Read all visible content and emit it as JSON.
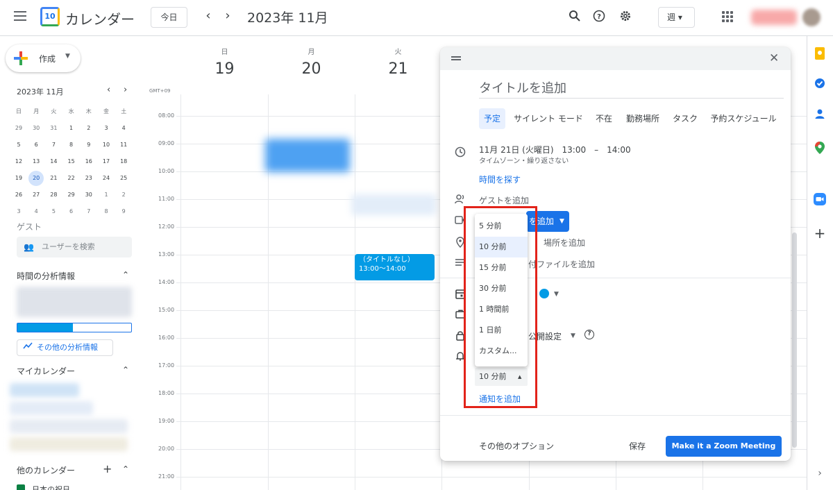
{
  "header": {
    "app_name": "カレンダー",
    "logo_number": "10",
    "today_button": "今日",
    "prev": "‹",
    "next": "›",
    "month_title": "2023年 11月",
    "view_selector": "週 ▾"
  },
  "sidebar": {
    "create_label": "作成",
    "mini_cal": {
      "title": "2023年 11月",
      "dows": [
        "日",
        "月",
        "火",
        "水",
        "木",
        "金",
        "土"
      ],
      "weeks": [
        [
          "29",
          "30",
          "31",
          "1",
          "2",
          "3",
          "4"
        ],
        [
          "5",
          "6",
          "7",
          "8",
          "9",
          "10",
          "11"
        ],
        [
          "12",
          "13",
          "14",
          "15",
          "16",
          "17",
          "18"
        ],
        [
          "19",
          "20",
          "21",
          "22",
          "23",
          "24",
          "25"
        ],
        [
          "26",
          "27",
          "28",
          "29",
          "30",
          "1",
          "2"
        ],
        [
          "3",
          "4",
          "5",
          "6",
          "7",
          "8",
          "9"
        ]
      ]
    },
    "guest_label": "ゲスト",
    "search_users_placeholder": "ユーザーを検索",
    "time_insights": "時間の分析情報",
    "more_insights": "その他の分析情報",
    "my_calendars": "マイカレンダー",
    "other_calendars": "他のカレンダー",
    "other_cal_item": "日本の祝日"
  },
  "week": {
    "timezone": "GMT+09",
    "days": [
      {
        "dow": "日",
        "num": "19"
      },
      {
        "dow": "月",
        "num": "20"
      },
      {
        "dow": "火",
        "num": "21"
      }
    ],
    "hours": [
      "08:00",
      "09:00",
      "10:00",
      "11:00",
      "12:00",
      "13:00",
      "14:00",
      "15:00",
      "16:00",
      "17:00",
      "18:00",
      "19:00",
      "20:00",
      "21:00"
    ],
    "event": {
      "title": "（タイトルなし）",
      "time": "13:00～14:00"
    }
  },
  "dialog": {
    "title_placeholder": "タイトルを追加",
    "tabs": [
      "予定",
      "サイレント モード",
      "不在",
      "勤務場所",
      "タスク",
      "予約スケジュール"
    ],
    "date_time": "11月 21日 (火曜日)　13:00　–　14:00",
    "tz_repeat": "タイムゾーン・繰り返さない",
    "find_time": "時間を探す",
    "add_guests": "ゲストを追加",
    "meet_button": "を追加",
    "add_location": "場所を追加",
    "add_attachment": "付ファイルを追加",
    "visibility": "公開設定",
    "notification_value": "10 分前",
    "add_notification": "通知を追加",
    "more_options": "その他のオプション",
    "save": "保存",
    "zoom_button": "Make it a Zoom Meeting"
  },
  "dropdown": {
    "options": [
      "5 分前",
      "10 分前",
      "15 分前",
      "30 分前",
      "1 時間前",
      "1 日前",
      "カスタム..."
    ],
    "selected_index": 1
  },
  "colors": {
    "accent": "#1a73e8",
    "event": "#039be5",
    "annotation": "#e2231a"
  }
}
